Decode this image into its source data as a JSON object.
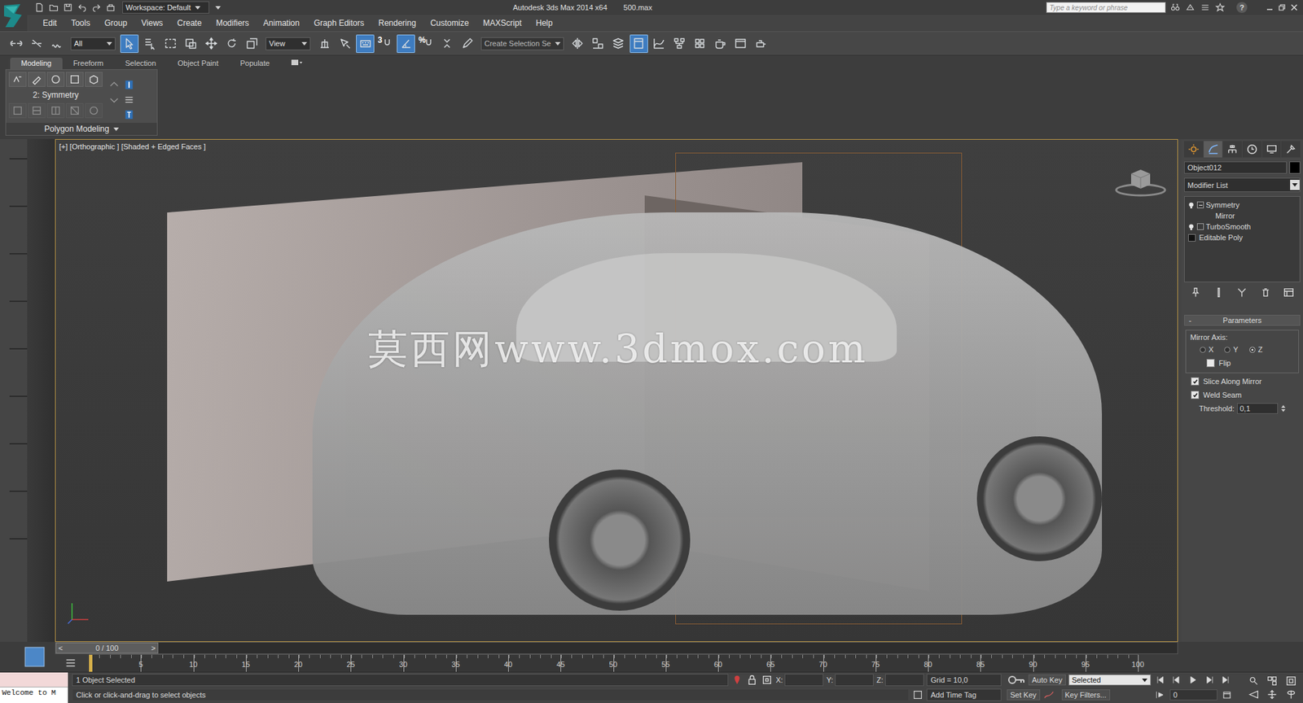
{
  "title_bar": {
    "workspace": "Workspace: Default",
    "title": "Autodesk 3ds Max  2014 x64",
    "file": "500.max",
    "search_placeholder": "Type a keyword or phrase",
    "help": "?"
  },
  "menu": [
    "Edit",
    "Tools",
    "Group",
    "Views",
    "Create",
    "Modifiers",
    "Animation",
    "Graph Editors",
    "Rendering",
    "Customize",
    "MAXScript",
    "Help"
  ],
  "toolbar": {
    "items": [
      {
        "kind": "button",
        "selected": false
      },
      {
        "kind": "button",
        "selected": false
      },
      {
        "kind": "button",
        "selected": false
      },
      {
        "kind": "dropdown",
        "text": "All"
      },
      {
        "kind": "button",
        "selected": true
      },
      {
        "kind": "button",
        "selected": false
      },
      {
        "kind": "button",
        "selected": false
      },
      {
        "kind": "button",
        "selected": false
      },
      {
        "kind": "button",
        "selected": false
      },
      {
        "kind": "button",
        "selected": false
      },
      {
        "kind": "button",
        "selected": false
      },
      {
        "kind": "dropdown",
        "text": "View"
      },
      {
        "kind": "button",
        "selected": false
      },
      {
        "kind": "button",
        "selected": false
      },
      {
        "kind": "button",
        "selected": true
      },
      {
        "kind": "button",
        "selected": false,
        "text": "3"
      },
      {
        "kind": "button",
        "selected": true
      },
      {
        "kind": "button",
        "selected": false,
        "text": "%"
      },
      {
        "kind": "button",
        "selected": false
      },
      {
        "kind": "button",
        "selected": false
      },
      {
        "kind": "field",
        "text": "Create Selection Se"
      },
      {
        "kind": "button",
        "selected": false
      },
      {
        "kind": "button",
        "selected": false
      },
      {
        "kind": "button",
        "selected": false
      },
      {
        "kind": "button",
        "selected": true
      },
      {
        "kind": "button",
        "selected": false
      },
      {
        "kind": "button",
        "selected": false
      },
      {
        "kind": "button",
        "selected": false
      },
      {
        "kind": "button",
        "selected": false
      },
      {
        "kind": "button",
        "selected": false
      },
      {
        "kind": "button",
        "selected": false
      }
    ]
  },
  "ribbon": {
    "tabs": [
      {
        "label": "Modeling",
        "selected": true
      },
      {
        "label": "Freeform",
        "selected": false
      },
      {
        "label": "Selection",
        "selected": false
      },
      {
        "label": "Object Paint",
        "selected": false
      },
      {
        "label": "Populate",
        "selected": false
      }
    ],
    "current": "2: Symmetry",
    "panel": "Polygon Modeling",
    "tools": [
      {
        "disabled": false
      },
      {
        "disabled": false
      },
      {
        "disabled": false
      },
      {
        "disabled": false
      },
      {
        "disabled": false
      }
    ],
    "lower_tools": [
      {
        "disabled": true
      },
      {
        "disabled": true
      },
      {
        "disabled": true
      },
      {
        "disabled": true
      },
      {
        "disabled": true
      }
    ]
  },
  "viewport": {
    "label": "[+] [Orthographic ] [Shaded + Edged Faces ]",
    "active": true,
    "watermark": "莫西网www.3dmox.com"
  },
  "command_panel": {
    "tabs": [
      {
        "selected": false
      },
      {
        "selected": true
      },
      {
        "selected": false
      },
      {
        "selected": false
      },
      {
        "selected": false
      },
      {
        "selected": false
      }
    ],
    "object_name": "Object012",
    "modifier_list": "Modifier List",
    "stack": [
      {
        "label": "Symmetry",
        "kind": "modifier",
        "on": true,
        "expanded": true,
        "selected": false
      },
      {
        "label": "Mirror",
        "kind": "subobject",
        "on": false,
        "expanded": false,
        "selected": false
      },
      {
        "label": "TurboSmooth",
        "kind": "modifier",
        "on": true,
        "expanded": false,
        "selected": false
      },
      {
        "label": "Editable Poly",
        "kind": "base",
        "on": false,
        "expanded": false,
        "selected": false
      }
    ],
    "rollout": {
      "collapse": "-",
      "title": "Parameters"
    },
    "mirror_axis": {
      "label": "Mirror Axis:",
      "options": [
        {
          "label": "X",
          "selected": false
        },
        {
          "label": "Y",
          "selected": false
        },
        {
          "label": "Z",
          "selected": true
        }
      ],
      "flip": {
        "label": "Flip",
        "checked": false
      }
    },
    "checks": [
      {
        "label": "Slice Along Mirror",
        "checked": true
      },
      {
        "label": "Weld Seam",
        "checked": true
      }
    ],
    "threshold": {
      "label": "Threshold:",
      "value": "0,1"
    }
  },
  "time_slider": {
    "prev": "<",
    "label": "0 / 100",
    "next": ">",
    "level": 0
  },
  "track_bar": {
    "ticks": [
      "5",
      "10",
      "15",
      "20",
      "25",
      "30",
      "35",
      "40",
      "45",
      "50",
      "55",
      "60",
      "65",
      "70",
      "75",
      "80",
      "85",
      "90",
      "95",
      "100"
    ],
    "current": 0
  },
  "status_bar": {
    "listener": "Welcome to M",
    "selection": "1 Object Selected",
    "prompt": "Click or click-and-drag to select objects",
    "coords": [
      {
        "label": "X:",
        "value": ""
      },
      {
        "label": "Y:",
        "value": ""
      },
      {
        "label": "Z:",
        "value": ""
      }
    ],
    "grid": "Grid = 10,0",
    "time_tag": "Add Time Tag",
    "auto_key": "Auto Key",
    "key_mode": "Selected",
    "set_key": "Set Key",
    "key_filters": "Key Filters...",
    "frame": "0"
  }
}
